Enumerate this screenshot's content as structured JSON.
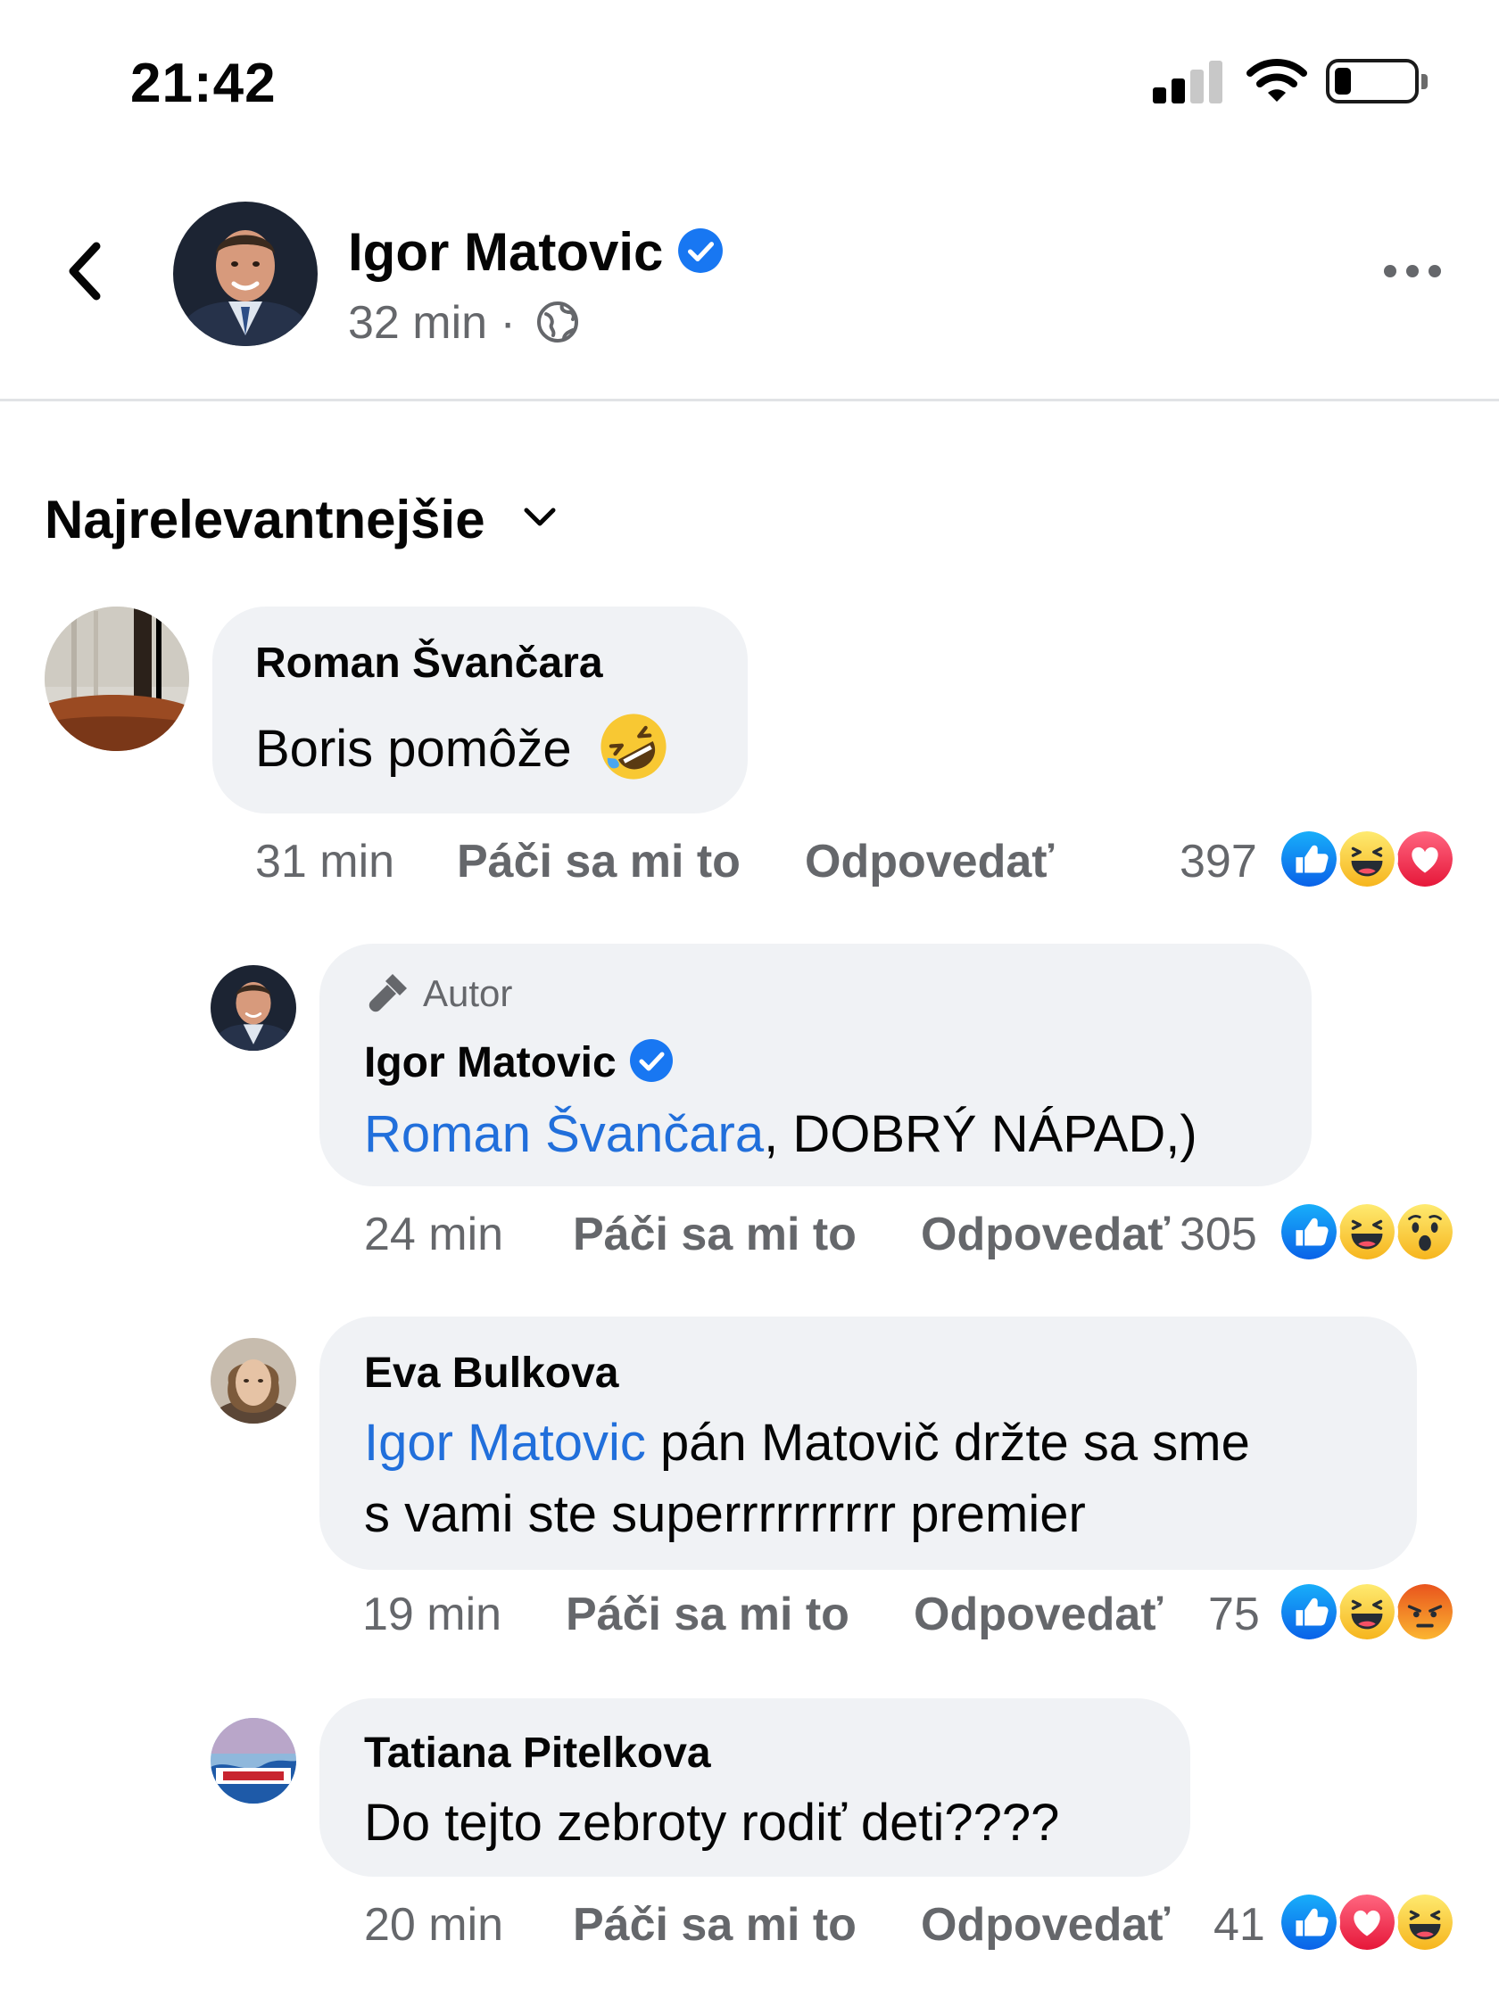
{
  "status_bar": {
    "time": "21:42",
    "battery_level": 0.2,
    "signal_bars": 2
  },
  "header": {
    "name": "Igor Matovic",
    "time": "32 min",
    "separator": "·",
    "icons": [
      "back-icon",
      "verified-icon",
      "globe-icon",
      "more-icon"
    ]
  },
  "sort": {
    "label": "Najrelevantnejšie",
    "icon": "chevron-down-icon"
  },
  "comments": [
    {
      "author": "Roman Švančara",
      "text": "Boris pomôže",
      "emoji": "rolling-on-floor-laughing",
      "time": "31 min",
      "like": "Páči sa mi to",
      "reply": "Odpovedať",
      "count": "397",
      "reactions": [
        "like",
        "haha",
        "love"
      ]
    },
    {
      "author_badge": "Autor",
      "author": "Igor Matovic",
      "mention": "Roman Švančara",
      "text": ", DOBRÝ NÁPAD,)",
      "time": "24 min",
      "like": "Páči sa mi to",
      "reply": "Odpovedať",
      "count": "305",
      "reactions": [
        "like",
        "haha",
        "wow"
      ]
    },
    {
      "author": "Eva Bulkova",
      "mention": "Igor Matovic",
      "text_line1": " pán Matovič držte sa sme",
      "text_line2": "s vami ste superrrrrrrrrr premier",
      "time": "19 min",
      "like": "Páči sa mi to",
      "reply": "Odpovedať",
      "count": "75",
      "reactions": [
        "like",
        "haha",
        "angry"
      ]
    },
    {
      "author": "Tatiana Pitelkova",
      "text": "Do tejto zebroty rodiť deti????",
      "time": "20 min",
      "like": "Páči sa mi to",
      "reply": "Odpovedať",
      "count": "41",
      "reactions": [
        "like",
        "love",
        "haha"
      ]
    }
  ],
  "colors": {
    "link": "#216fdb",
    "like_blue": "#1877f2",
    "love_red": "#f33e58",
    "haha_yellow": "#fbc02d",
    "bubble": "#f0f2f5",
    "meta_grey": "#65676b"
  }
}
